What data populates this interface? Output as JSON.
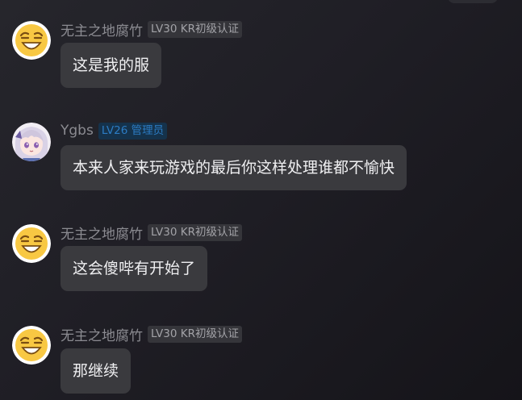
{
  "messages": [
    {
      "avatar": "laughing-emoji-avatar",
      "username": "无主之地腐竹",
      "badge": "LV30 KR初级认证",
      "badge_type": "level",
      "text": "这是我的服"
    },
    {
      "avatar": "anime-girl-avatar",
      "username": "Ygbs",
      "badge": "LV26 管理员",
      "badge_type": "admin",
      "text": "本来人家来玩游戏的最后你这样处理谁都不愉快"
    },
    {
      "avatar": "laughing-emoji-avatar",
      "username": "无主之地腐竹",
      "badge": "LV30 KR初级认证",
      "badge_type": "level",
      "text": "这会傻哔有开始了"
    },
    {
      "avatar": "laughing-emoji-avatar",
      "username": "无主之地腐竹",
      "badge": "LV30 KR初级认证",
      "badge_type": "level",
      "text": "那继续"
    }
  ],
  "colors": {
    "background": "#1f1e25",
    "bubble": "#3a3a3e",
    "bubble_text": "#efeff1",
    "username": "#8b8b91",
    "level_badge_bg": "#35353a",
    "level_badge_text": "#a2a2a7",
    "admin_badge_bg": "#15324b",
    "admin_badge_text": "#2c7cc4"
  }
}
